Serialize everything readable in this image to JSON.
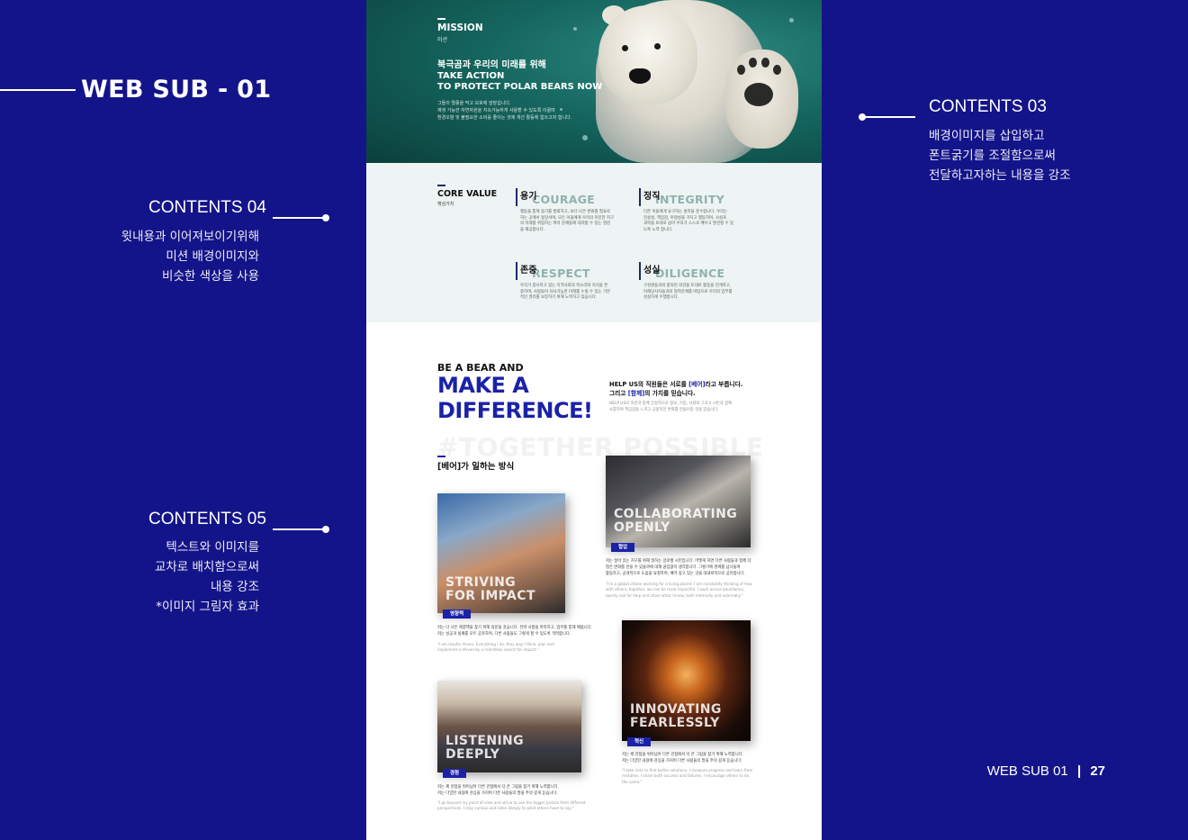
{
  "slide": {
    "title": "WEB SUB - 01",
    "contents03": {
      "heading": "CONTENTS 03",
      "lines": [
        "배경이미지를 삽입하고",
        "폰트굵기를 조절함으로써",
        "전달하고자하는 내용을 강조"
      ]
    },
    "contents04": {
      "heading": "CONTENTS 04",
      "lines": [
        "윗내용과 이어져보이기위해",
        "미션 배경이미지와",
        "비슷한 색상을 사용"
      ]
    },
    "contents05": {
      "heading": "CONTENTS 05",
      "lines": [
        "텍스트와 이미지를",
        "교차로 배치함으로써",
        "내용 강조",
        "*이미지 그림자 효과"
      ]
    },
    "footer": {
      "label": "WEB SUB 01",
      "page": "27"
    }
  },
  "hero": {
    "label": "MISSION",
    "label_ko": "미션",
    "tagline_ko": "북극곰과 우리의 미래를 위해",
    "take_action_1": "TAKE ACTION",
    "take_action_2": "TO PROTECT POLAR BEARS NOW",
    "desc_1": "그들의 멸종을 막고 보호에 앞장섭니다.",
    "desc_2": "재생 가능한 자연자원을 지속가능하게 사용할 수 있도록 이끌며",
    "desc_3": "환경오염 및 불필요한 소비를 줄이는 것에 개선 활동에 힘쓰고자 합니다."
  },
  "core_value": {
    "title": "CORE VALUE",
    "subtitle": "핵심가치",
    "items": [
      {
        "ko": "용기",
        "en": "COURAGE",
        "d1": "행동을 통해 용기를 발휘하고, 보다 나은 변화를 필요로",
        "d2": "하는 곳에서 앞장서며, 모든 이들에게 우리의 미진한 지구",
        "d3": "의 미래를 위협하는 여러 문제들에 대처할 수 있는 영감",
        "d4": "을 제공합니다."
      },
      {
        "ko": "정직",
        "en": "INTEGRITY",
        "d1": "다른 이들에게 요구하는 원칙을 준수합니다. 우리는",
        "d2": "진실성, 책임감, 투명성을 가지고 행동하며, 사실과",
        "d3": "과학을 토대로 삼아 우리가 스스로 배우고 발전할 수 있",
        "d4": "도록 노력 합니다."
      },
      {
        "ko": "존중",
        "en": "RESPECT",
        "d1": "우리가 봉사하고 있는 지역사회의 목소리와 지식을 존",
        "d2": "중하며, 사람들이 자녀가능한 미래를 누릴 수 있는 기본",
        "d3": "적인 권리를 보장하기 위해 노력하고 있습니다.",
        "d4": ""
      },
      {
        "ko": "성실",
        "en": "DILIGENCE",
        "d1": "구성원들과의 합의된 의견을 토대로 활동을 전개하고,",
        "d2": "이해당사자들과의 협력관계를 바탕으로 우리의 임무를",
        "d3": "성실하게 수행합니다.",
        "d4": ""
      }
    ]
  },
  "difference": {
    "pre": "BE A BEAR AND",
    "headline_1": "MAKE A",
    "headline_2": "DIFFERENCE!",
    "help_1a": "HELP US의 직원들은 서로를 ",
    "help_1b": "[베어]",
    "help_1c": "라고 부릅니다.",
    "help_2a": "그리고 ",
    "help_2b": "[함께]",
    "help_2c": "의 가치를 믿습니다.",
    "help_sub_1": "HELP US의 미션과 함께 궁정적으로 정보, 기업, 사회와 그리고 시민과 함께",
    "help_sub_2": "소통하며 책임감을 느끼고 긍정적인 변화를 만들어갈 것을 믿습니다.",
    "watermark": "#TOGETHER POSSIBLE",
    "way_title": "[베어]가 일하는 방식"
  },
  "cards": [
    {
      "cap_1": "STRIVING",
      "cap_2": "FOR IMPACT",
      "tag": "영향력",
      "t1": "저는 더 나은 해결책을 찾기 위해 의문을 갖습니다. 전략 사항을 파악하고, 업무를 통해 배웁니다.",
      "t2": "저는 성공과 실패를 모두 공유하며, 다른 사람들도 그렇게 할 수 있도록 격려합니다.",
      "q1": "\"I am results driven. Everything I do, they way I think, plan and",
      "q2": "implement is driven by a relentless search for impact.\""
    },
    {
      "cap_1": "COLLABORATING",
      "cap_2": "OPENLY",
      "tag": "협업",
      "t1": "저는 살아 있는 지구를 위해 일하는 글로벌 시민입니다. 어떻게 하면 다른 사람들과 함께 더",
      "t2": "많은 변화를 만들 수 있을까에 대해 끊임없이 생각합니다. 그렇기에 경계를 넘나들며",
      "t3": "활동하고, 공개적으로 도움을 요청하며, 배려 깊고 있는 것을 대내외적으로 공유합니다.",
      "q1": "\"I'm a global citizen working for a living planet. I am constantly thinking of how",
      "q2": "with others, together, we can be more impactful. I work across boundaries,",
      "q3": "openly ask for help and share what I know, both internally and externally.\""
    },
    {
      "cap_1": "INNOVATING",
      "cap_2": "FEARLESSLY",
      "tag": "혁신",
      "t1": "저는 제 관점을 뛰어넘어 다른 관점에서 더 큰 그림을 찾기 위해 노력합니다.",
      "t2": "저는 다양한 내용에 관심을 가지며 다른 사람들의 말을 주의 깊게 듣습니다.",
      "q1": "\"I take risks to find better solutions. I measure progress and learn from",
      "q2": "mistakes. I share both success and failures. I encourage others to do",
      "q3": "the same.\""
    },
    {
      "cap_1": "LISTENING",
      "cap_2": "DEEPLY",
      "tag": "경청",
      "t1": "저는 제 관점을 뛰어넘어 다른 관점에서 더 큰 그림을 찾기 위해 노력합니다.",
      "t2": "저는 다양한 내용에 관심을 가지며 다른 사람들의 말을 주의 깊게 듣습니다.",
      "q1": "\"I go beyond my point of view and strive to see the bigger picture from different",
      "q2": "perspectives. I stay curious and listen deeply to what others have to say.\""
    }
  ]
}
